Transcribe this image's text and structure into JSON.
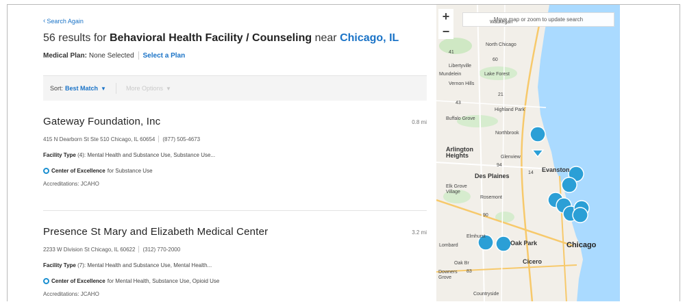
{
  "nav": {
    "back_label": "Search Again"
  },
  "search": {
    "count_text": "56 results for",
    "query": "Behavioral Health Facility / Counseling",
    "near_text": "near",
    "location": "Chicago, IL"
  },
  "plan": {
    "label": "Medical Plan:",
    "value": "None Selected",
    "select_label": "Select a Plan"
  },
  "sortbar": {
    "sort_label": "Sort:",
    "sort_value": "Best Match",
    "more_label": "More Options"
  },
  "results": [
    {
      "name": "Gateway Foundation, Inc",
      "distance": "0.8 mi",
      "address": "415 N Dearborn St Ste 510 Chicago, IL 60654",
      "phone": "(877) 505-4673",
      "facility_type_label": "Facility Type",
      "facility_type_count": "(4):",
      "facility_type_value": "Mental Health and Substance Use, Substance Use...",
      "coe_label": "Center of Excellence",
      "coe_value": "for Substance Use",
      "accreditations": "Accreditations: JCAHO"
    },
    {
      "name": "Presence St Mary and Elizabeth Medical Center",
      "distance": "3.2 mi",
      "address": "2233 W Division St Chicago, IL 60622",
      "phone": "(312) 770-2000",
      "facility_type_label": "Facility Type",
      "facility_type_count": "(7):",
      "facility_type_value": "Mental Health and Substance Use, Mental Health...",
      "coe_label": "Center of Excellence",
      "coe_value": "for Mental Health, Substance Use, Opioid Use",
      "accreditations": "Accreditations: JCAHO"
    }
  ],
  "map": {
    "search_note": "Move map or zoom to update search",
    "zoom_in": "+",
    "zoom_out": "−",
    "labels": {
      "waukegan": "Waukegan",
      "north_chicago": "North Chicago",
      "libertyville": "Libertyville",
      "mundelein": "Mundelein",
      "lake_forest": "Lake Forest",
      "vernon_hills": "Vernon Hills",
      "highland_park": "Highland Park",
      "buffalo_grove": "Buffalo Grove",
      "northbrook": "Northbrook",
      "arlington_heights": "Arlington Heights",
      "glenview": "Glenview",
      "evanston": "Evanston",
      "des_plaines": "Des Plaines",
      "elk_grove_village": "Elk Grove Village",
      "rosemont": "Rosemont",
      "elmhurst": "Elmhurst",
      "oak_park": "Oak Park",
      "chicago": "Chicago",
      "lombard": "Lombard",
      "cicero": "Cicero",
      "oak_brook": "Oak Br",
      "downers_grove": "Downers Grove",
      "countryside": "Countryside",
      "route_41": "41",
      "route_43": "43",
      "route_60": "60",
      "route_21": "21",
      "route_94": "94",
      "route_14": "14",
      "route_90": "90",
      "route_83": "83"
    },
    "colors": {
      "water": "#aadaff",
      "land": "#f2efe9",
      "pin": "#2b9fd6",
      "pin_border": "#ffffff"
    }
  }
}
